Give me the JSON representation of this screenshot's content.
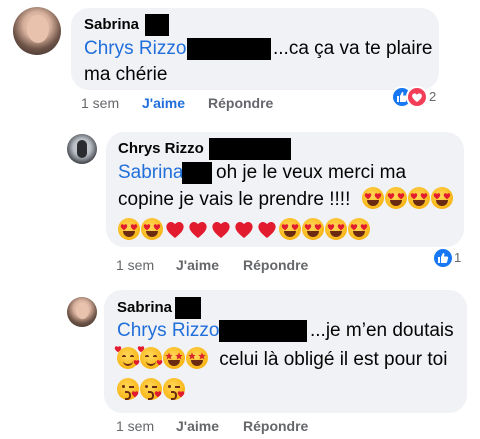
{
  "comments": [
    {
      "author": "Sabrina",
      "mention": "Chrys Rizzo",
      "text_line1": "...ca ça va te plaire",
      "text_line2": "ma chérie",
      "time": "1 sem",
      "like_label": "J'aime",
      "reply_label": "Répondre",
      "reaction_count": "2",
      "reaction_icons": [
        "like-icon",
        "love-icon"
      ]
    },
    {
      "author": "Chrys Rizzo",
      "mention": "Sabrina",
      "text_line1": "oh je le veux merci ma",
      "text_line2": "copine je vais le prendre !!!!",
      "time": "1 sem",
      "like_label": "J'aime",
      "reply_label": "Répondre",
      "reaction_count": "1",
      "reaction_icons": [
        "like-icon"
      ],
      "emojis_line2": [
        "heart-eyes",
        "heart-eyes",
        "heart-eyes",
        "heart-eyes"
      ],
      "emojis_line3": [
        "heart-eyes",
        "heart-eyes",
        "red-heart",
        "red-heart",
        "red-heart",
        "red-heart",
        "red-heart",
        "heart-eyes",
        "heart-eyes",
        "heart-eyes",
        "heart-eyes"
      ]
    },
    {
      "author": "Sabrina",
      "mention": "Chrys Rizzo",
      "text_line1": "...je m’en doutais",
      "text_line2": "celui là obligé il est pour toi",
      "time": "1 sem",
      "like_label": "J'aime",
      "reply_label": "Répondre",
      "emojis_line2": [
        "smiling-hearts",
        "smiling-hearts",
        "star-struck",
        "star-struck"
      ],
      "emojis_line3": [
        "kissing-heart",
        "kissing-heart",
        "kissing-heart"
      ]
    }
  ],
  "colors": {
    "mention": "#216fdb",
    "bubble": "#f0f2f5",
    "like": "#216fdb",
    "love": "#f33e58"
  }
}
